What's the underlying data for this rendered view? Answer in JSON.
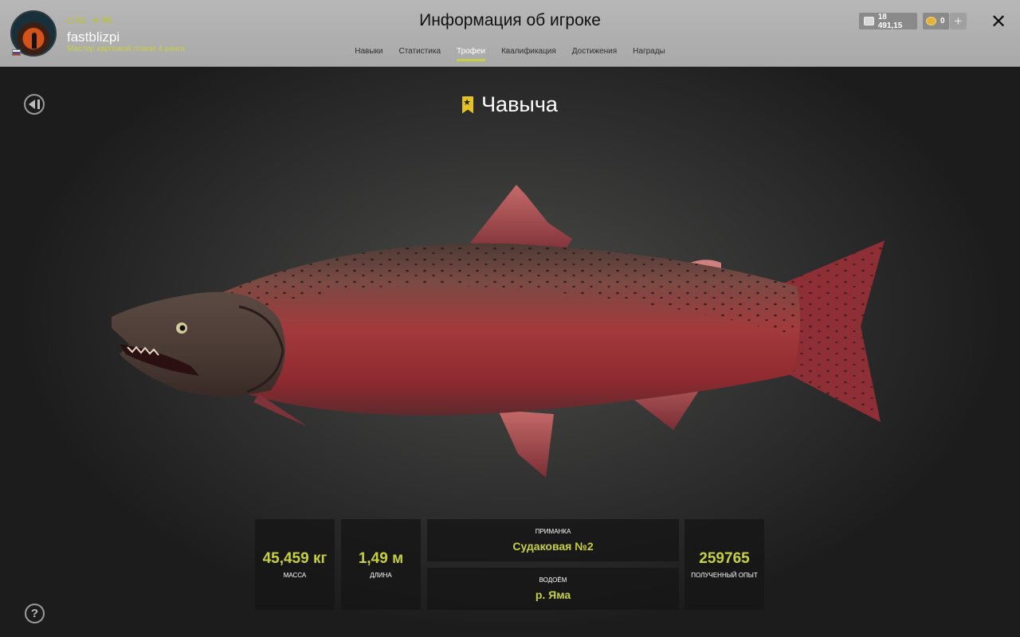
{
  "header": {
    "level": "41",
    "stars": "50",
    "username": "fastblizpi",
    "rank": "Мастер карповой ловли 4 ранга",
    "title": "Информация об игроке",
    "tabs": [
      {
        "label": "Навыки",
        "active": false
      },
      {
        "label": "Статистика",
        "active": false
      },
      {
        "label": "Трофеи",
        "active": true
      },
      {
        "label": "Квалификация",
        "active": false
      },
      {
        "label": "Достижения",
        "active": false
      },
      {
        "label": "Награды",
        "active": false
      }
    ],
    "silver": "18 491,15",
    "gold": "0",
    "plus": "+",
    "close": "✕"
  },
  "trophy": {
    "fish_name": "Чавыча",
    "mass_value": "45,459 кг",
    "mass_label": "Масса",
    "length_value": "1,49 м",
    "length_label": "Длина",
    "bait_label": "Приманка",
    "bait_value": "Судаковая №2",
    "water_label": "Водоём",
    "water_value": "р. Яма",
    "xp_value": "259765",
    "xp_label": "Полученный опыт"
  },
  "help": "?",
  "colors": {
    "accent": "#c7d03d",
    "header_bg": "#b0b0b0",
    "panel_bg": "#161616"
  }
}
